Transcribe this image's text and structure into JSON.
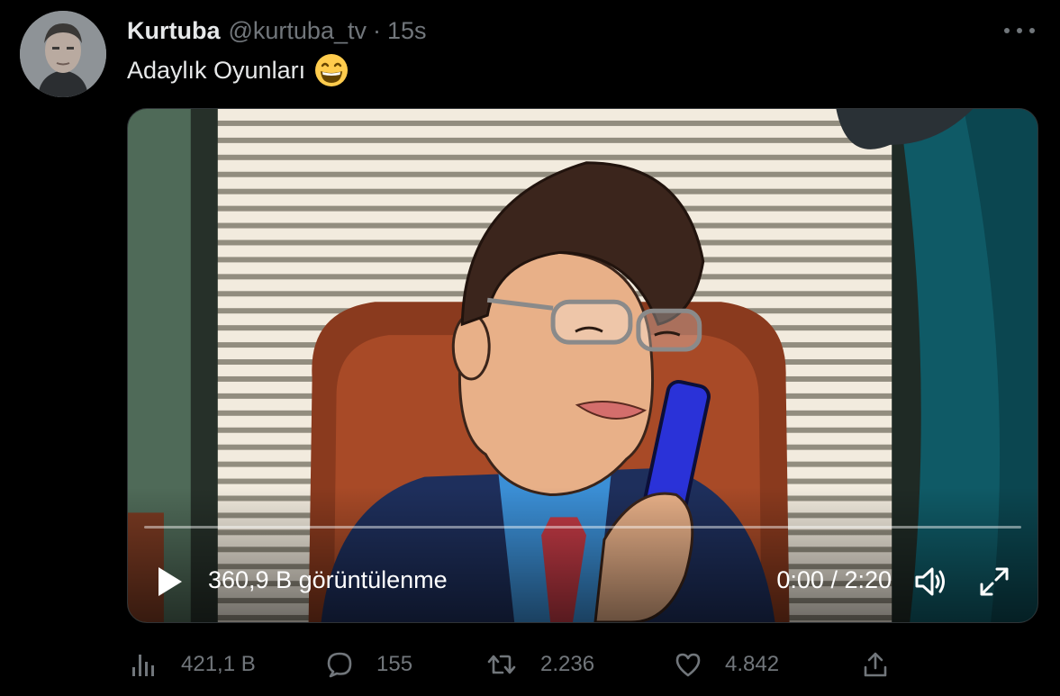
{
  "author": {
    "display_name": "Kurtuba",
    "handle": "@kurtuba_tv",
    "separator": "·",
    "time": "15s"
  },
  "tweet": {
    "text": "Adaylık Oyunları",
    "emoji": "grinning-face-with-smiling-eyes"
  },
  "video": {
    "views": "360,9 B görüntülenme",
    "timecode": "0:00 / 2:20",
    "progress_fraction": 0,
    "icons": [
      "play-icon",
      "volume-icon",
      "fullscreen-icon"
    ]
  },
  "actions": {
    "views": "421,1 B",
    "replies": "155",
    "retweets": "2.236",
    "likes": "4.842"
  },
  "colors": {
    "background": "#000000",
    "text_primary": "#e7e9ea",
    "text_secondary": "#71767b",
    "accent": "#1d9bf0"
  }
}
